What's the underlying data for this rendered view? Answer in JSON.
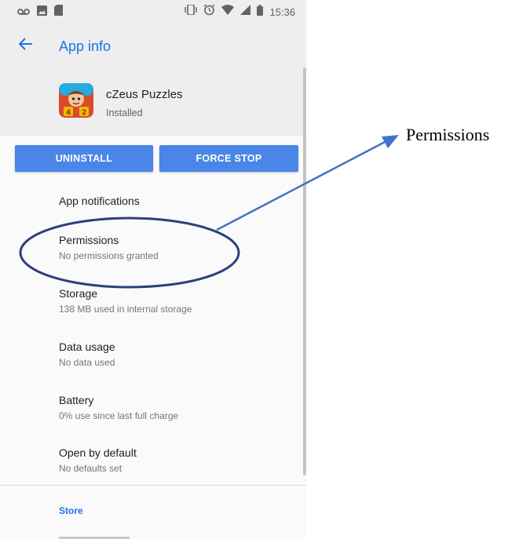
{
  "status_bar": {
    "time": "15:36",
    "left_icons": [
      "voicemail-icon",
      "image-notification-icon",
      "sd-card-icon"
    ],
    "right_icons": [
      "vibrate-icon",
      "alarm-icon",
      "wifi-icon",
      "signal-icon",
      "battery-icon"
    ]
  },
  "app_bar": {
    "title": "App info",
    "back_icon": "back-arrow-icon"
  },
  "app": {
    "name": "cZeus Puzzles",
    "status": "Installed",
    "icon": "app-icon"
  },
  "buttons": {
    "uninstall": "UNINSTALL",
    "force_stop": "FORCE STOP"
  },
  "items": [
    {
      "title": "App notifications",
      "subtitle": ""
    },
    {
      "title": "Permissions",
      "subtitle": "No permissions granted"
    },
    {
      "title": "Storage",
      "subtitle": "138 MB used in internal storage"
    },
    {
      "title": "Data usage",
      "subtitle": "No data used"
    },
    {
      "title": "Battery",
      "subtitle": "0% use since last full charge"
    },
    {
      "title": "Open by default",
      "subtitle": "No defaults set"
    }
  ],
  "section": {
    "store": "Store"
  },
  "annotation": {
    "label": "Permissions",
    "color": "#2e3f7a",
    "arrow_color": "#4472c4"
  },
  "colors": {
    "accent": "#1a73e8",
    "button": "#4a86e8",
    "header_bg": "#eeeeee"
  }
}
